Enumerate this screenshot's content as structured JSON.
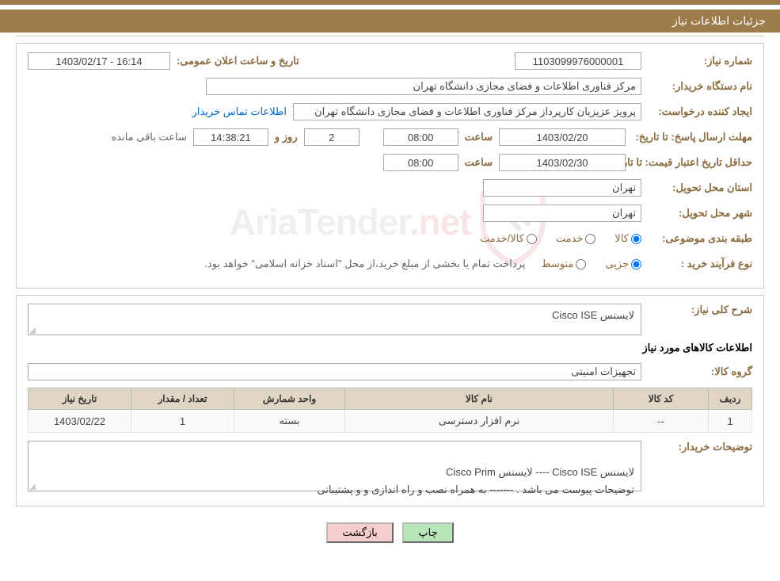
{
  "header": {
    "title": "جزئیات اطلاعات نیاز"
  },
  "info": {
    "request_no_label": "شماره نیاز:",
    "request_no": "1103099976000001",
    "announce_label": "تاریخ و ساعت اعلان عمومی:",
    "announce_value": "16:14 - 1403/02/17",
    "buyer_org_label": "نام دستگاه خریدار:",
    "buyer_org": "مرکز فناوری اطلاعات و فضای مجازی دانشگاه تهران",
    "requester_label": "ایجاد کننده درخواست:",
    "requester": "پرویز عزیزیان کارپرداز مرکز فناوری اطلاعات و فضای مجازی دانشگاه تهران",
    "buyer_contact_link": "اطلاعات تماس خریدار",
    "deadline_label": "مهلت ارسال پاسخ: تا تاریخ:",
    "deadline_date": "1403/02/20",
    "time_label": "ساعت",
    "deadline_time": "08:00",
    "days_label": "روز و",
    "days_value": "2",
    "countdown": "14:38:21",
    "remaining_label": "ساعت باقی مانده",
    "price_valid_label": "حداقل تاریخ اعتبار قیمت: تا تاریخ:",
    "price_valid_date": "1403/02/30",
    "price_valid_time": "08:00",
    "province_label": "استان محل تحویل:",
    "province": "تهران",
    "city_label": "شهر محل تحویل:",
    "city": "تهران",
    "subject_class_label": "طبقه بندی موضوعی:",
    "opt_goods": "کالا",
    "opt_service": "خدمت",
    "opt_both": "کالا/خدمت",
    "purchase_type_label": "نوع فرآیند خرید :",
    "opt_small": "جزیی",
    "opt_medium": "متوسط",
    "purchase_note": "پرداخت تمام یا بخشی از مبلغ خرید،از محل \"اسناد خزانه اسلامی\" خواهد بود."
  },
  "details": {
    "summary_label": "شرح کلی نیاز:",
    "summary_text": "لایسنس Cisco ISE",
    "items_title": "اطلاعات کالاهای مورد نیاز",
    "group_label": "گروه کالا:",
    "group_value": "تجهیزات امنیتی",
    "table_headers": {
      "row": "ردیف",
      "code": "کد کالا",
      "name": "نام کالا",
      "unit": "واحد شمارش",
      "qty": "تعداد / مقدار",
      "date": "تاریخ نیاز"
    },
    "table_row": {
      "row": "1",
      "code": "--",
      "name": "نرم افزار دسترسی",
      "unit": "بسته",
      "qty": "1",
      "date": "1403/02/22"
    },
    "buyer_notes_label": "توضیحات خریدار:",
    "buyer_notes": "لایسنس Cisco ISE ---- لایسنس Cisco  Prim\nتوضیحات پیوست می باشد . ------- به همراه نصب و راه اندازی و و پشتیبانی"
  },
  "buttons": {
    "print": "چاپ",
    "back": "بازگشت"
  },
  "watermark": {
    "text1": "AriaTender",
    "text2": ".net"
  }
}
